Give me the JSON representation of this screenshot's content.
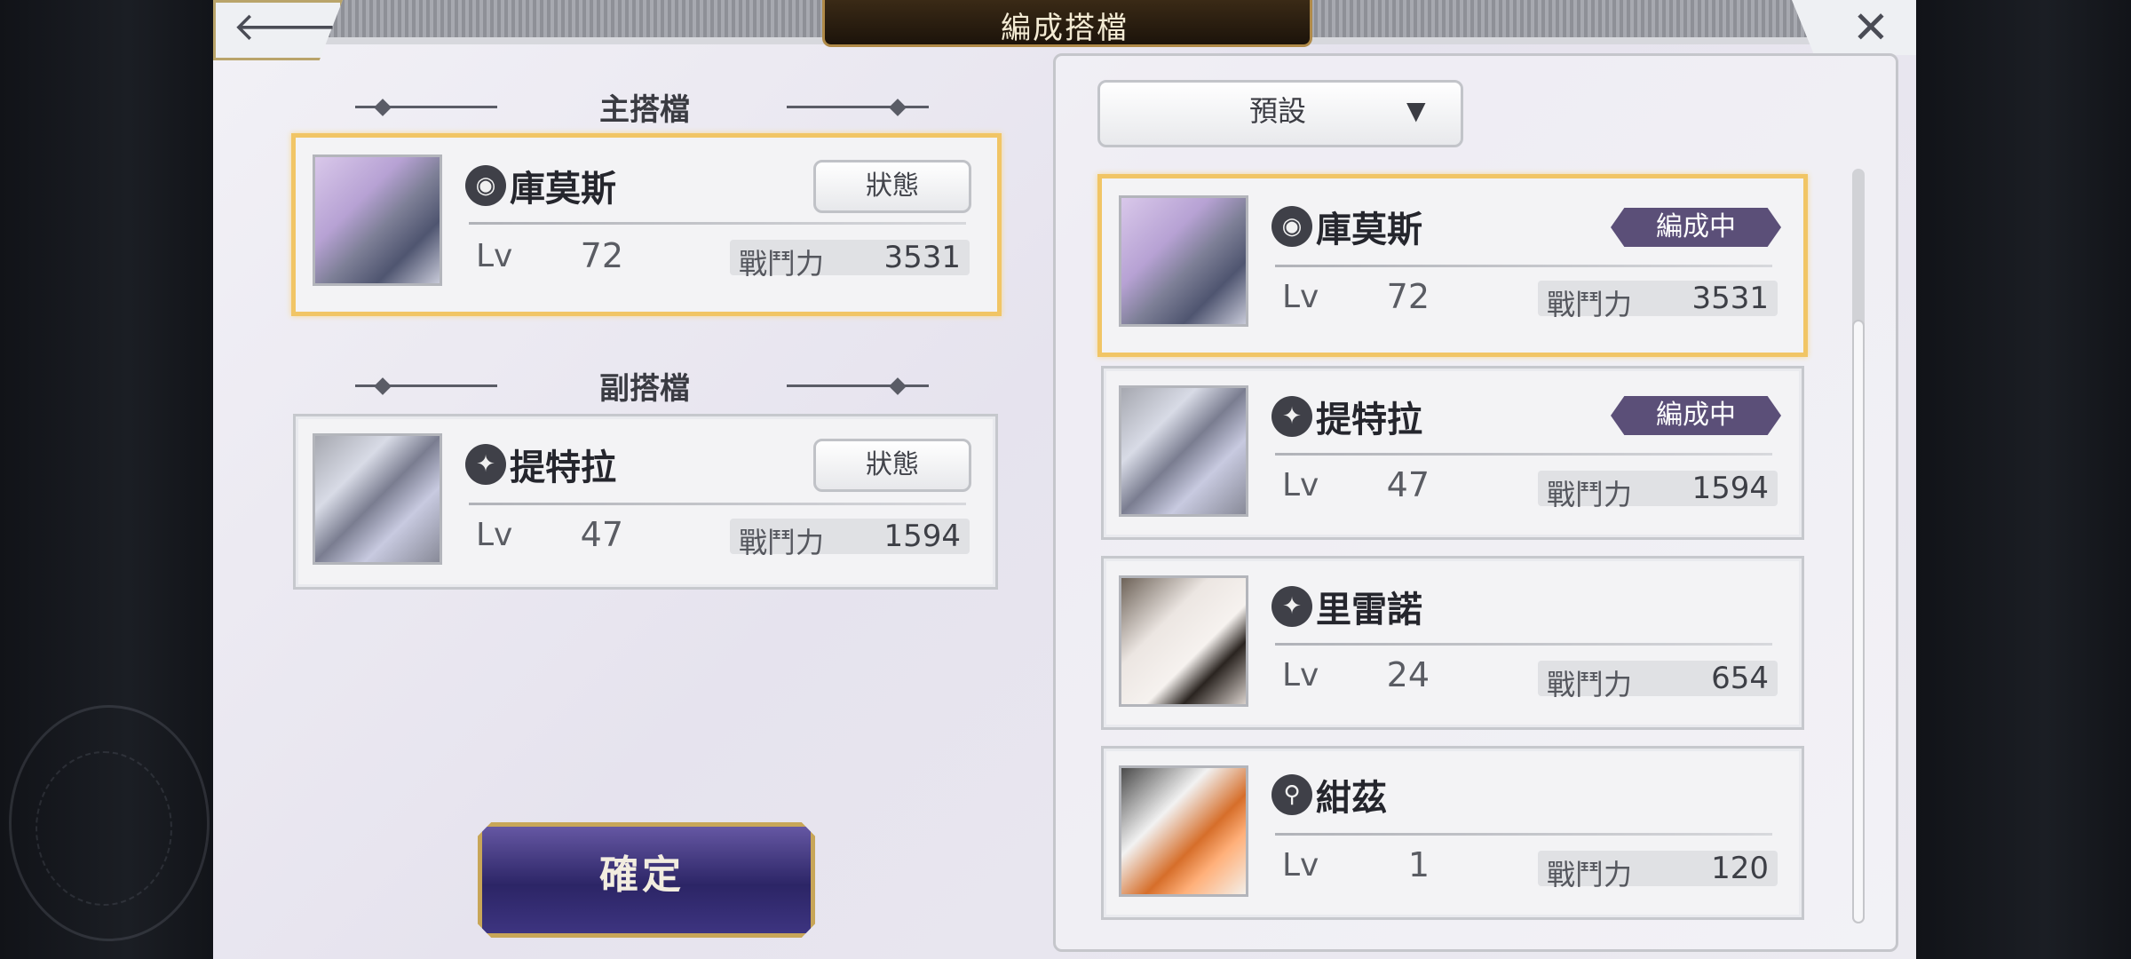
{
  "header": {
    "title": "編成搭檔"
  },
  "left": {
    "main_section_title": "主搭檔",
    "sub_section_title": "副搭檔",
    "main_partner": {
      "name": "庫莫斯",
      "element_icon": "eye-icon",
      "lv_label": "Lv",
      "level": "72",
      "power_label": "戰鬥力",
      "power": "3531",
      "status_label": "狀態"
    },
    "sub_partner": {
      "name": "提特拉",
      "element_icon": "star-burst-icon",
      "lv_label": "Lv",
      "level": "47",
      "power_label": "戰鬥力",
      "power": "1594",
      "status_label": "狀態"
    },
    "confirm_label": "確定"
  },
  "right": {
    "dropdown_selected": "預設",
    "list": [
      {
        "name": "庫莫斯",
        "element_icon": "eye-icon",
        "lv_label": "Lv",
        "level": "72",
        "power_label": "戰鬥力",
        "power": "3531",
        "badge": "編成中"
      },
      {
        "name": "提特拉",
        "element_icon": "star-burst-icon",
        "lv_label": "Lv",
        "level": "47",
        "power_label": "戰鬥力",
        "power": "1594",
        "badge": "編成中"
      },
      {
        "name": "里雷諾",
        "element_icon": "star-burst-icon",
        "lv_label": "Lv",
        "level": "24",
        "power_label": "戰鬥力",
        "power": "654",
        "badge": ""
      },
      {
        "name": "紺茲",
        "element_icon": "key-icon",
        "lv_label": "Lv",
        "level": "1",
        "power_label": "戰鬥力",
        "power": "120",
        "badge": ""
      }
    ]
  },
  "colors": {
    "active_border": "#f1c565",
    "badge_bg": "#5b4f78",
    "confirm_bg": "#2c2566"
  }
}
